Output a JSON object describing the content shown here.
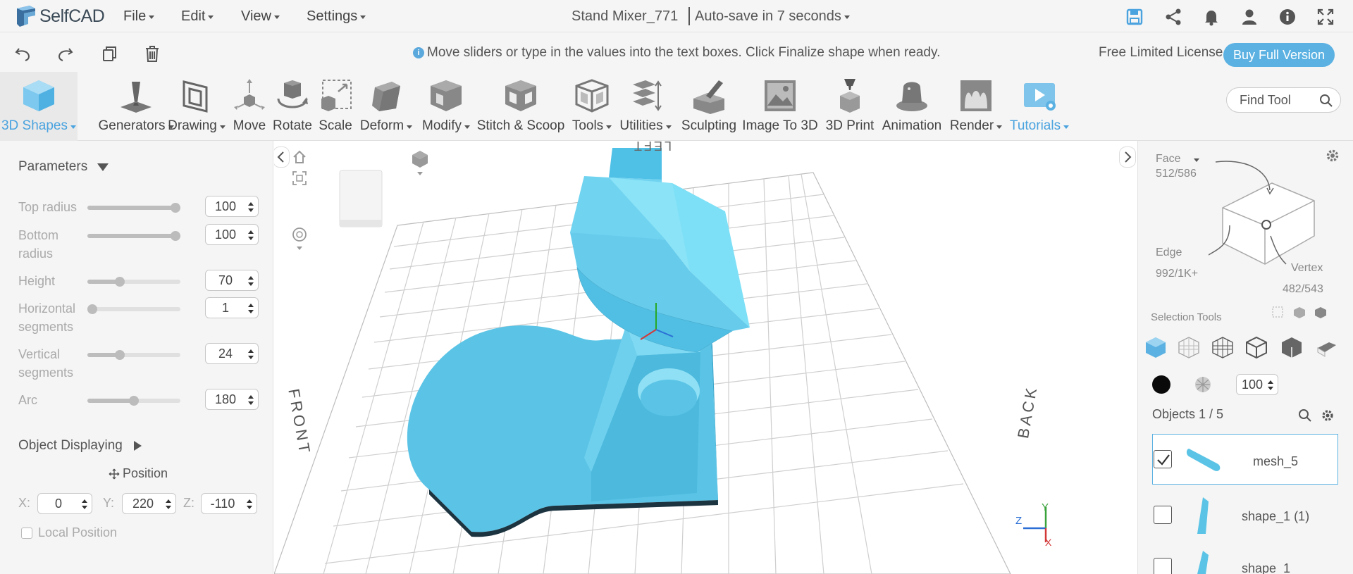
{
  "app": {
    "name": "SelfCAD",
    "document_title": "Stand Mixer_771",
    "autosave": "Auto-save in 7 seconds"
  },
  "menu": [
    {
      "label": "File"
    },
    {
      "label": "Edit"
    },
    {
      "label": "View"
    },
    {
      "label": "Settings"
    }
  ],
  "top_icons": [
    "save-icon",
    "share-icon",
    "bell-icon",
    "user-icon",
    "info-icon",
    "fullscreen-icon"
  ],
  "hint": {
    "message": "Move sliders or type in the values into the text boxes. Click Finalize shape when ready.",
    "license": "Free Limited License",
    "buy_label": "Buy Full Version"
  },
  "edit_icons": [
    "undo-icon",
    "redo-icon",
    "copy-icon",
    "delete-icon"
  ],
  "toolbar": {
    "tools": [
      {
        "label": "3D Shapes",
        "dropdown": true,
        "active": true
      },
      {
        "label": "Generators",
        "dropdown": true
      },
      {
        "label": "Drawing",
        "dropdown": true
      },
      {
        "label": "Move",
        "dropdown": false
      },
      {
        "label": "Rotate",
        "dropdown": false
      },
      {
        "label": "Scale",
        "dropdown": false
      },
      {
        "label": "Deform",
        "dropdown": true
      },
      {
        "label": "Modify",
        "dropdown": true
      },
      {
        "label": "Stitch & Scoop",
        "dropdown": false
      },
      {
        "label": "Tools",
        "dropdown": true
      },
      {
        "label": "Utilities",
        "dropdown": true
      },
      {
        "label": "Sculpting",
        "dropdown": false
      },
      {
        "label": "Image To 3D",
        "dropdown": false
      },
      {
        "label": "3D Print",
        "dropdown": false
      },
      {
        "label": "Animation",
        "dropdown": false
      },
      {
        "label": "Render",
        "dropdown": true
      },
      {
        "label": "Tutorials",
        "dropdown": true,
        "tutorial": true
      }
    ],
    "find_placeholder": "Find Tool"
  },
  "parameters": {
    "title": "Parameters",
    "items": [
      {
        "label": "Top radius",
        "value": "100",
        "level": 1.0
      },
      {
        "label": "Bottom radius",
        "value": "100",
        "level": 1.0
      },
      {
        "label": "Height",
        "value": "70",
        "level": 0.35
      },
      {
        "label": "Horizontal segments",
        "value": "1",
        "level": 0.0
      },
      {
        "label": "Vertical segments",
        "value": "24",
        "level": 0.35
      },
      {
        "label": "Arc",
        "value": "180",
        "level": 0.5
      }
    ]
  },
  "object_displaying": {
    "title": "Object Displaying",
    "position_label": "Position",
    "x_label": "X:",
    "x": "0",
    "y_label": "Y:",
    "y": "220",
    "z_label": "Z:",
    "z": "-110",
    "local_position": "Local Position"
  },
  "viewport": {
    "labels": {
      "left": "LEFT",
      "front": "FRONT",
      "back": "BACK"
    },
    "axes": {
      "x": "X",
      "y": "Y",
      "z": "Z"
    },
    "cube_label": "front"
  },
  "selection": {
    "face_label": "Face",
    "face_count": "512/586",
    "edge_label": "Edge",
    "edge_count": "992/1K+",
    "vertex_label": "Vertex",
    "vertex_count": "482/543",
    "tools_label": "Selection Tools",
    "opacity": "100"
  },
  "objects": {
    "header": "Objects 1 / 5",
    "items": [
      {
        "name": "mesh_5",
        "checked": true
      },
      {
        "name": "shape_1 (1)",
        "checked": false
      },
      {
        "name": "shape_1",
        "checked": false
      }
    ]
  },
  "colors": {
    "accent": "#5ab1e2",
    "shape": "#5bc4e6",
    "panel": "#f5f5f5"
  }
}
